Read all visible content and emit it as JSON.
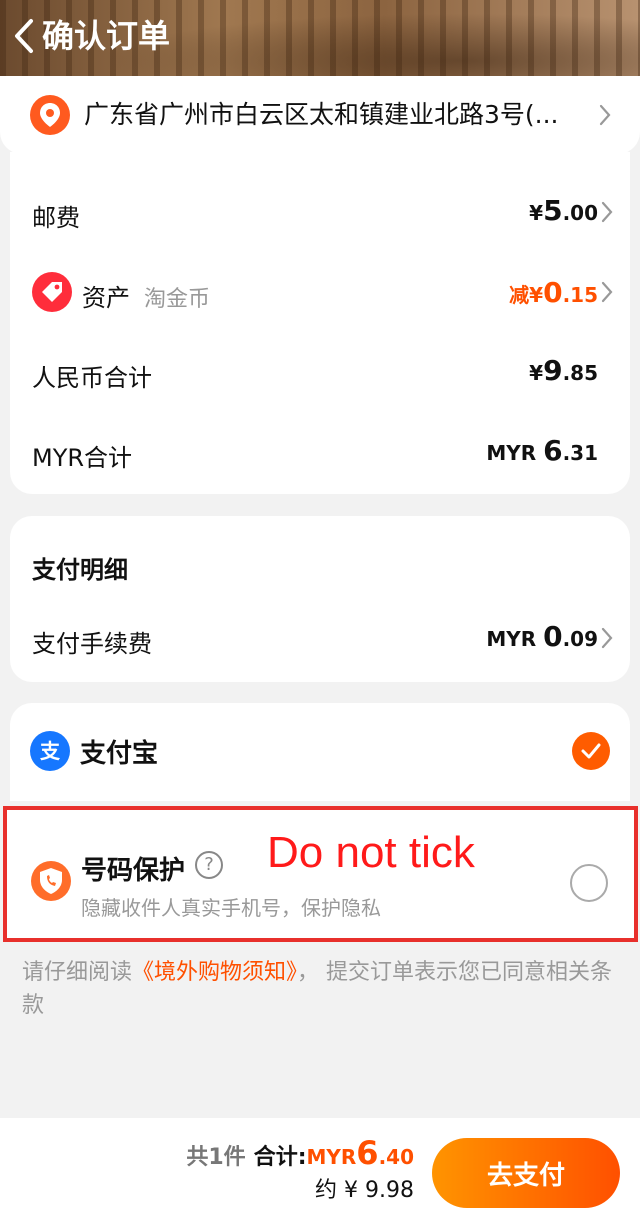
{
  "header": {
    "title": "确认订单"
  },
  "address": {
    "text": "广东省广州市白云区太和镇建业北路3号(..."
  },
  "fees": {
    "shipping": {
      "label": "邮费",
      "currency": "¥",
      "int": "5",
      "dec": ".00"
    },
    "assets": {
      "label": "资产",
      "sublabel": "淘金币",
      "prefix": "减",
      "currency": "¥",
      "int": "0",
      "dec": ".15"
    },
    "rmb_total": {
      "label": "人民币合计",
      "currency": "¥",
      "int": "9",
      "dec": ".85"
    },
    "myr_total": {
      "label": "MYR合计",
      "currency": "MYR ",
      "int": "6",
      "dec": ".31"
    }
  },
  "payment_details": {
    "title": "支付明细",
    "fee": {
      "label": "支付手续费",
      "currency": "MYR ",
      "int": "0",
      "dec": ".09"
    }
  },
  "method": {
    "label": "支付宝",
    "selected": true
  },
  "protection": {
    "title": "号码保护",
    "subtitle": "隐藏收件人真实手机号，保护隐私",
    "annotation": "Do not tick",
    "checked": false
  },
  "terms": {
    "prefix": "请仔细阅读",
    "link": "《境外购物须知》",
    "suffix": "， 提交订单表示您已同意相关条款"
  },
  "bottom": {
    "count": "共1件",
    "total_label": "合计:",
    "currency": "MYR",
    "int": "6",
    "dec": ".40",
    "approx": "约 ¥ 9.98",
    "pay_button": "去支付"
  },
  "colors": {
    "accent": "#ff5000",
    "alipay": "#1677ff",
    "annotation_border": "#e8302c"
  }
}
